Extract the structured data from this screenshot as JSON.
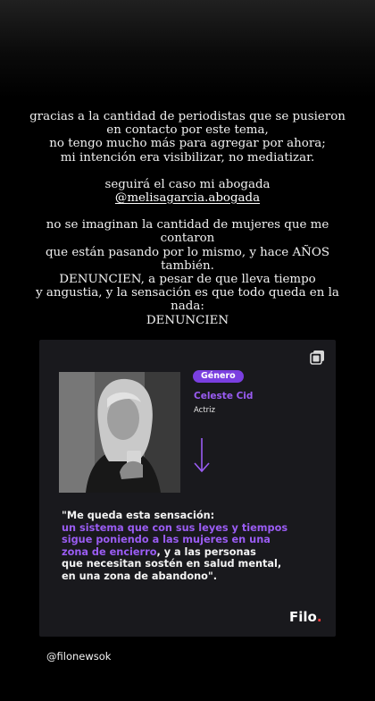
{
  "story": {
    "paragraph1": [
      "gracias a la cantidad de periodistas que se pusieron",
      "en contacto por este tema,",
      "no tengo mucho más para agregar por ahora;",
      "mi intención era visibilizar, no mediatizar."
    ],
    "paragraph2_line1": "seguirá el caso mi abogada",
    "mention": "@melisagarcia.abogada",
    "paragraph3": [
      "no se imaginan la cantidad de mujeres que me contaron",
      "que están pasando por lo mismo, y hace AÑOS también.",
      "DENUNCIEN, a pesar de que lleva tiempo",
      "y angustia, y la sensación es que todo queda en la nada:",
      "DENUNCIEN"
    ]
  },
  "embed": {
    "badge": "Género",
    "name": "Celeste Cid",
    "role": "Actriz",
    "quote_open": "\"Me queda esta sensación:",
    "quote_highlight": [
      "un sistema que con sus leyes y tiempos",
      "sigue poniendo a las mujeres en una",
      "zona de encierro"
    ],
    "quote_rest": [
      ", y a las personas",
      "que necesitan sostén en salud mental,",
      "en una zona de abandono\"."
    ],
    "logo": "Filo",
    "logo_dot": ".",
    "accent": "#7a3fe0"
  },
  "handle": "@filonewsok",
  "icons": {
    "copy": "copy-icon",
    "arrow": "arrow-down-icon"
  }
}
